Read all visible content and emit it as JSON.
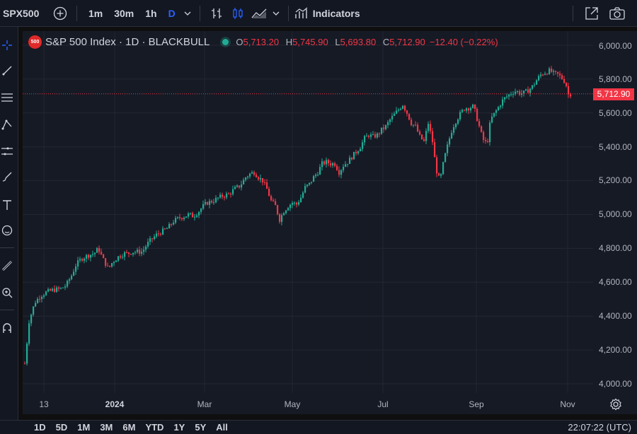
{
  "toolbar": {
    "symbol": "SPX500",
    "intervals": [
      "1m",
      "30m",
      "1h",
      "D"
    ],
    "active_interval": "D",
    "indicators_label": "Indicators"
  },
  "legend": {
    "logo_text": "500",
    "title": "S&P 500 Index · 1D · BLACKBULL",
    "o_key": "O",
    "o_val": "5,713.20",
    "h_key": "H",
    "h_val": "5,745.90",
    "l_key": "L",
    "l_val": "5,693.80",
    "c_key": "C",
    "c_val": "5,712.90",
    "change": "−12.40 (−0.22%)",
    "up_color": "#22ab94",
    "down_color": "#f23645"
  },
  "price_axis": {
    "labels": [
      "6,000.00",
      "5,800.00",
      "5,600.00",
      "5,400.00",
      "5,200.00",
      "5,000.00",
      "4,800.00",
      "4,600.00",
      "4,400.00",
      "4,200.00",
      "4,000.00"
    ],
    "last_price": "5,712.90"
  },
  "time_axis": {
    "labels": [
      "13",
      "2024",
      "Mar",
      "May",
      "Jul",
      "Sep",
      "Nov"
    ]
  },
  "bottom_bar": {
    "ranges": [
      "1D",
      "5D",
      "1M",
      "3M",
      "6M",
      "YTD",
      "1Y",
      "5Y",
      "All"
    ],
    "clock": "22:07:22 (UTC)"
  },
  "chart_data": {
    "type": "line",
    "y_range": [
      4000,
      6000
    ],
    "last_close": 5712.9,
    "points": [
      [
        0,
        4120
      ],
      [
        6,
        4370
      ],
      [
        14,
        4480
      ],
      [
        22,
        4520
      ],
      [
        30,
        4540
      ],
      [
        40,
        4555
      ],
      [
        50,
        4560
      ],
      [
        58,
        4580
      ],
      [
        66,
        4640
      ],
      [
        72,
        4700
      ],
      [
        80,
        4740
      ],
      [
        90,
        4760
      ],
      [
        98,
        4770
      ],
      [
        104,
        4800
      ],
      [
        110,
        4740
      ],
      [
        118,
        4680
      ],
      [
        124,
        4720
      ],
      [
        132,
        4750
      ],
      [
        140,
        4770
      ],
      [
        146,
        4770
      ],
      [
        152,
        4780
      ],
      [
        158,
        4780
      ],
      [
        166,
        4780
      ],
      [
        172,
        4820
      ],
      [
        178,
        4850
      ],
      [
        186,
        4880
      ],
      [
        194,
        4900
      ],
      [
        202,
        4920
      ],
      [
        210,
        4960
      ],
      [
        218,
        4980
      ],
      [
        226,
        4990
      ],
      [
        232,
        5000
      ],
      [
        238,
        4990
      ],
      [
        246,
        5020
      ],
      [
        252,
        5050
      ],
      [
        258,
        5070
      ],
      [
        266,
        5080
      ],
      [
        274,
        5100
      ],
      [
        280,
        5110
      ],
      [
        288,
        5120
      ],
      [
        296,
        5150
      ],
      [
        304,
        5170
      ],
      [
        312,
        5220
      ],
      [
        318,
        5240
      ],
      [
        324,
        5250
      ],
      [
        330,
        5220
      ],
      [
        336,
        5200
      ],
      [
        342,
        5150
      ],
      [
        348,
        5080
      ],
      [
        354,
        5050
      ],
      [
        360,
        4970
      ],
      [
        366,
        5020
      ],
      [
        372,
        5050
      ],
      [
        378,
        5070
      ],
      [
        384,
        5060
      ],
      [
        390,
        5100
      ],
      [
        396,
        5160
      ],
      [
        402,
        5180
      ],
      [
        408,
        5220
      ],
      [
        414,
        5250
      ],
      [
        420,
        5300
      ],
      [
        426,
        5310
      ],
      [
        432,
        5300
      ],
      [
        438,
        5300
      ],
      [
        444,
        5250
      ],
      [
        450,
        5290
      ],
      [
        456,
        5310
      ],
      [
        462,
        5340
      ],
      [
        468,
        5370
      ],
      [
        474,
        5400
      ],
      [
        480,
        5450
      ],
      [
        486,
        5470
      ],
      [
        492,
        5460
      ],
      [
        498,
        5470
      ],
      [
        504,
        5500
      ],
      [
        510,
        5520
      ],
      [
        516,
        5560
      ],
      [
        522,
        5590
      ],
      [
        528,
        5620
      ],
      [
        534,
        5650
      ],
      [
        540,
        5600
      ],
      [
        546,
        5540
      ],
      [
        552,
        5520
      ],
      [
        558,
        5460
      ],
      [
        564,
        5430
      ],
      [
        570,
        5540
      ],
      [
        576,
        5430
      ],
      [
        580,
        5300
      ],
      [
        584,
        5210
      ],
      [
        588,
        5230
      ],
      [
        592,
        5320
      ],
      [
        598,
        5420
      ],
      [
        604,
        5510
      ],
      [
        610,
        5560
      ],
      [
        616,
        5600
      ],
      [
        622,
        5630
      ],
      [
        628,
        5630
      ],
      [
        634,
        5640
      ],
      [
        638,
        5580
      ],
      [
        642,
        5520
      ],
      [
        646,
        5460
      ],
      [
        650,
        5420
      ],
      [
        654,
        5440
      ],
      [
        658,
        5560
      ],
      [
        664,
        5600
      ],
      [
        670,
        5640
      ],
      [
        676,
        5680
      ],
      [
        682,
        5700
      ],
      [
        688,
        5720
      ],
      [
        694,
        5730
      ],
      [
        700,
        5715
      ],
      [
        706,
        5720
      ],
      [
        712,
        5735
      ],
      [
        718,
        5760
      ],
      [
        724,
        5800
      ],
      [
        730,
        5830
      ],
      [
        736,
        5840
      ],
      [
        742,
        5850
      ],
      [
        748,
        5830
      ],
      [
        752,
        5830
      ],
      [
        758,
        5810
      ],
      [
        764,
        5780
      ],
      [
        768,
        5710
      ],
      [
        772,
        5713
      ]
    ]
  }
}
